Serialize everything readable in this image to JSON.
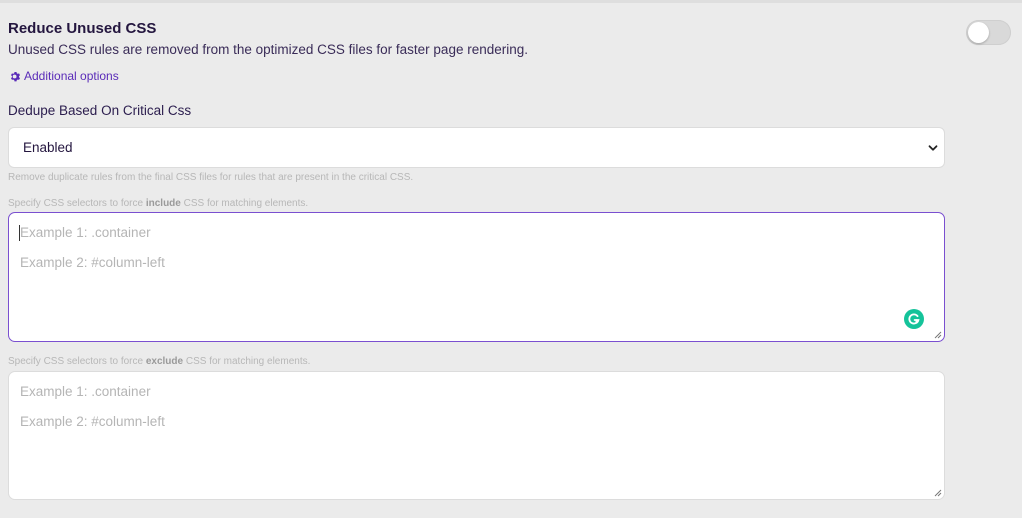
{
  "setting": {
    "title": "Reduce Unused CSS",
    "description": "Unused CSS rules are removed from the optimized CSS files for faster page rendering.",
    "toggle_on": false,
    "additional_options_label": "Additional options"
  },
  "dedupe": {
    "label": "Dedupe Based On Critical Css",
    "selected_value": "Enabled",
    "help_text": "Remove duplicate rules from the final CSS files for rules that are present in the critical CSS."
  },
  "include": {
    "help_prefix": "Specify CSS selectors to force ",
    "help_keyword": "include",
    "help_suffix": " CSS for matching elements.",
    "placeholder_line1": "Example 1: .container",
    "placeholder_line2": "Example 2: #column-left"
  },
  "exclude": {
    "help_prefix": "Specify CSS selectors to force ",
    "help_keyword": "exclude",
    "help_suffix": " CSS for matching elements.",
    "placeholder_line1": "Example 1: .container",
    "placeholder_line2": "Example 2: #column-left"
  },
  "colors": {
    "accent": "#5a2bb8",
    "focus_border": "#7a4fd0",
    "grammarly": "#15c39a"
  }
}
